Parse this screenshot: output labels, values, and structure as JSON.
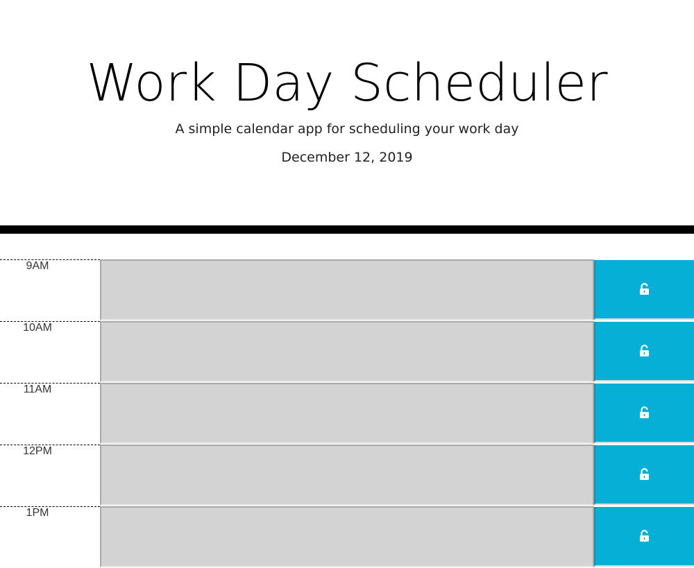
{
  "header": {
    "title": "Work Day Scheduler",
    "subtitle": "A simple calendar app for scheduling your work day",
    "current_date": "December 12, 2019"
  },
  "colors": {
    "past_block": "#d3d3d3",
    "save_button": "#06afd6",
    "divider": "#000000"
  },
  "timeblocks": [
    {
      "hour": "9AM",
      "text": "",
      "save_icon": "unlock-icon"
    },
    {
      "hour": "10AM",
      "text": "",
      "save_icon": "unlock-icon"
    },
    {
      "hour": "11AM",
      "text": "",
      "save_icon": "unlock-icon"
    },
    {
      "hour": "12PM",
      "text": "",
      "save_icon": "unlock-icon"
    },
    {
      "hour": "1PM",
      "text": "",
      "save_icon": "unlock-icon"
    }
  ]
}
